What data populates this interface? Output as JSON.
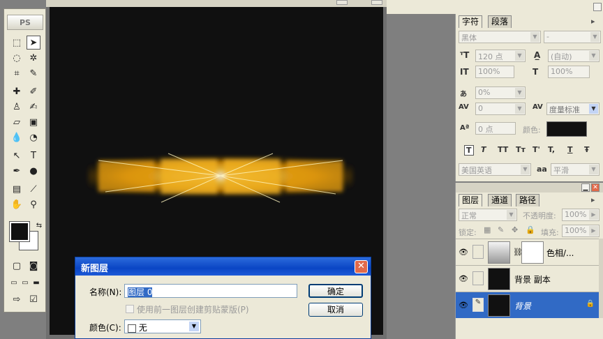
{
  "toolbox": {
    "logo_text": "PS"
  },
  "dialog": {
    "title": "新图层",
    "name_label": "名称(N):",
    "name_value": "图层 0",
    "clipping_label": "使用前一图层创建剪贴蒙版(P)",
    "color_label": "颜色(C):",
    "color_value": "无",
    "ok_label": "确定",
    "cancel_label": "取消"
  },
  "character_panel": {
    "tab_char": "字符",
    "tab_para": "段落",
    "font_family": "黑体",
    "font_style": "-",
    "font_size": "120 点",
    "leading": "(自动)",
    "vertical_scale": "100%",
    "horizontal_scale": "100%",
    "tracking_pct": "0%",
    "kerning": "0",
    "tracking_type": "度量标准",
    "baseline_shift": "0 点",
    "color_label": "颜色:",
    "color_value": "#111111",
    "language": "美国英语",
    "aa_label": "aa",
    "antialias": "平滑",
    "style_buttons": [
      "T",
      "T",
      "TT",
      "Tт",
      "T'",
      "T,",
      "T",
      "Ŧ"
    ]
  },
  "layers_panel": {
    "tab_layers": "图层",
    "tab_channels": "通道",
    "tab_paths": "路径",
    "blend_mode": "正常",
    "opacity_label": "不透明度:",
    "opacity_value": "100%",
    "lock_label": "锁定:",
    "fill_label": "填充:",
    "fill_value": "100%",
    "layers": [
      {
        "name": "色相/...",
        "active": false
      },
      {
        "name": "背景 副本",
        "active": false
      },
      {
        "name": "背景",
        "active": true
      }
    ]
  }
}
